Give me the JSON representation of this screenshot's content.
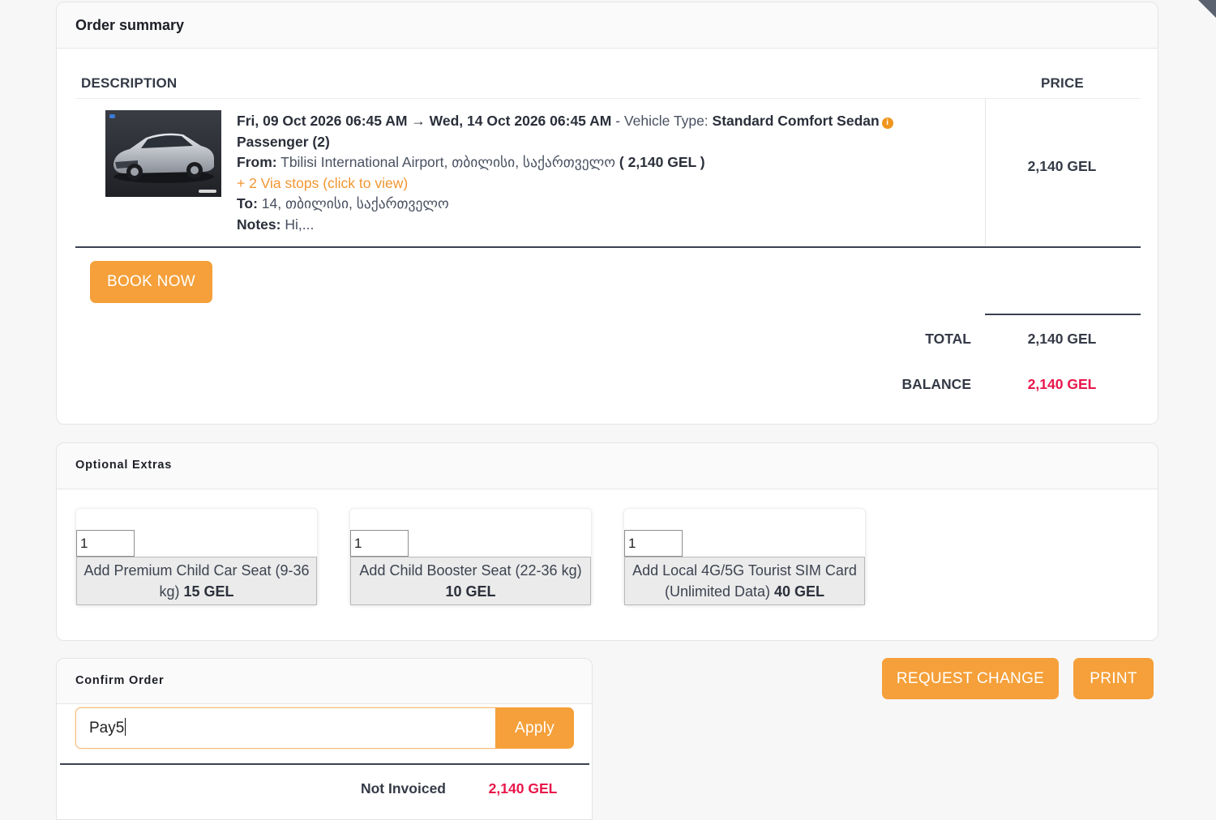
{
  "order_summary": {
    "title": "Order summary",
    "headers": {
      "description": "DESCRIPTION",
      "price": "PRICE"
    },
    "item": {
      "dates": "Fri, 09 Oct 2026 06:45 AM → Wed, 14 Oct 2026 06:45 AM",
      "vehicle_sep": " - Vehicle Type: ",
      "vehicle_type": "Standard Comfort Sedan",
      "passenger": "Passenger (2)",
      "from_label": "From:",
      "from_value": "Tbilisi International Airport, თბილისი, საქართველო",
      "from_price": "( 2,140 GEL )",
      "via_stops": "+ 2 Via stops (click to view)",
      "to_label": "To:",
      "to_value": "14, თბილისი, საქართველო",
      "notes_label": "Notes:",
      "notes_value": "Hi,...",
      "price": "2,140 GEL"
    },
    "book_now": "BOOK NOW",
    "total_label": "TOTAL",
    "total_value": "2,140 GEL",
    "balance_label": "BALANCE",
    "balance_value": "2,140 GEL"
  },
  "extras": {
    "title": "Optional Extras",
    "items": [
      {
        "qty": "1",
        "label": "Add Premium Child Car Seat (9-36 kg)",
        "price": "15 GEL"
      },
      {
        "qty": "1",
        "label": "Add Child Booster Seat (22-36 kg)",
        "price": "10 GEL"
      },
      {
        "qty": "1",
        "label": "Add Local 4G/5G Tourist SIM Card (Unlimited Data)",
        "price": "40 GEL"
      }
    ]
  },
  "confirm": {
    "title": "Confirm Order",
    "coupon_value": "Pay5",
    "apply": "Apply",
    "status_label": "Not Invoiced",
    "status_value": "2,140 GEL"
  },
  "actions": {
    "request_change": "REQUEST CHANGE",
    "print": "PRINT"
  },
  "colors": {
    "accent": "#f5a03a",
    "balance": "#e8174a",
    "link": "#f29630"
  }
}
